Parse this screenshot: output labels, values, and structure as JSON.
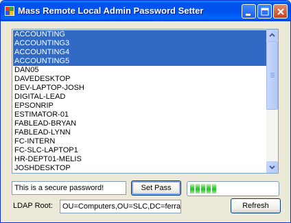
{
  "window": {
    "title": "Mass Remote Local Admin Password Setter"
  },
  "computers": [
    {
      "name": "ACCOUNTING",
      "selected": true
    },
    {
      "name": "ACCOUNTING3",
      "selected": true
    },
    {
      "name": "ACCOUNTING4",
      "selected": true
    },
    {
      "name": "ACCOUNTING5",
      "selected": true
    },
    {
      "name": "DAN05",
      "selected": false
    },
    {
      "name": "DAVEDESKTOP",
      "selected": false
    },
    {
      "name": "DEV-LAPTOP-JOSH",
      "selected": false
    },
    {
      "name": "DIGITAL-LEAD",
      "selected": false
    },
    {
      "name": "EPSONRIP",
      "selected": false
    },
    {
      "name": "ESTIMATOR-01",
      "selected": false
    },
    {
      "name": "FABLEAD-BRYAN",
      "selected": false
    },
    {
      "name": "FABLEAD-LYNN",
      "selected": false
    },
    {
      "name": "FC-INTERN",
      "selected": false
    },
    {
      "name": "FC-SLC-LAPTOP1",
      "selected": false
    },
    {
      "name": "HR-DEPT01-MELIS",
      "selected": false
    },
    {
      "name": "JOSHDESKTOP",
      "selected": false
    }
  ],
  "password": {
    "value": "This is a secure password!"
  },
  "set_pass_button": {
    "label": "Set Pass"
  },
  "progress": {
    "filled_segments": 5,
    "total_segments": 16,
    "color": "#2cc12c"
  },
  "ldap": {
    "label": "LDAP Root:",
    "value": "OU=Computers,OU=SLC,DC=ferrari"
  },
  "refresh_button": {
    "label": "Refresh"
  },
  "colors": {
    "selection": "#316ac5",
    "titlebar": "#0053ee"
  }
}
